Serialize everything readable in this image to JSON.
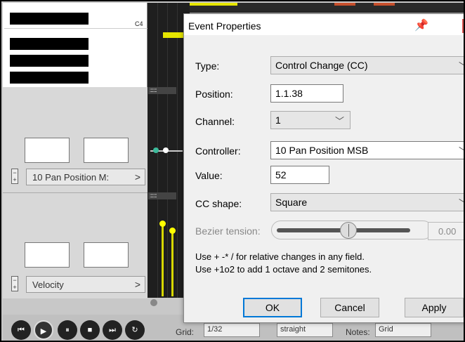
{
  "piano": {
    "note_label": "C4"
  },
  "cc_lane": {
    "selector_label": "10 Pan Position M:",
    "chevron": ">"
  },
  "velocity_lane": {
    "selector_label": "Velocity",
    "chevron": ">"
  },
  "lane_header_marker": "::::::::",
  "transport": {
    "buttons": [
      "skip-back",
      "play",
      "pause",
      "stop",
      "skip-forward",
      "repeat"
    ],
    "grid_label": "Grid:",
    "grid_value": "1/32",
    "swing_value": "straight",
    "notes_label": "Notes:",
    "notes_value": "Grid"
  },
  "dialog": {
    "title": "Event Properties",
    "fields": {
      "type_label": "Type:",
      "type_value": "Control Change (CC)",
      "position_label": "Position:",
      "position_value": "1.1.38",
      "channel_label": "Channel:",
      "channel_value": "1",
      "controller_label": "Controller:",
      "controller_value": "10 Pan Position MSB",
      "value_label": "Value:",
      "value_value": "52",
      "cc_shape_label": "CC shape:",
      "cc_shape_value": "Square",
      "bezier_label": "Bezier tension:",
      "bezier_value": "0.00"
    },
    "hint_line1": "Use + -* / for relative changes in any field.",
    "hint_line2": "Use +1o2  to add 1 octave and 2 semitones.",
    "buttons": {
      "ok": "OK",
      "cancel": "Cancel",
      "apply": "Apply"
    }
  },
  "colors": {
    "accent_yellow": "#e6e600",
    "close_red": "#d9534f",
    "focus_blue": "#0078d7"
  }
}
